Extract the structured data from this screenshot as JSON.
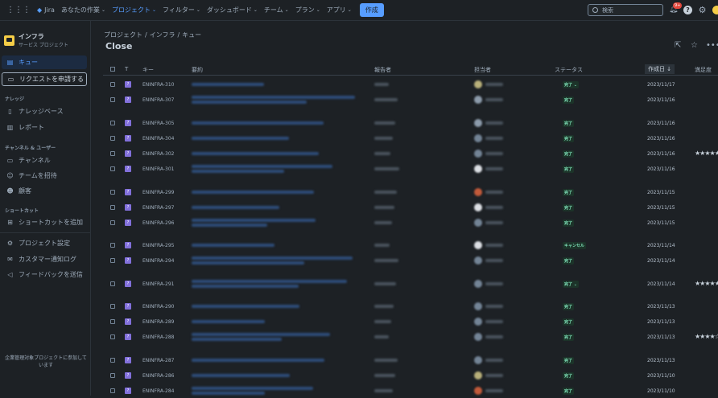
{
  "topbar": {
    "app": "Jira",
    "nav": [
      "あなたの作業",
      "プロジェクト",
      "フィルター",
      "ダッシュボード",
      "チーム",
      "プラン",
      "アプリ"
    ],
    "create": "作成",
    "search_placeholder": "検索",
    "notif_badge": "9+"
  },
  "sidebar": {
    "project_name": "インフラ",
    "project_type": "サービス プロジェクト",
    "items": [
      {
        "label": "キュー",
        "icon": "queue-icon"
      },
      {
        "label": "リクエストを申請する",
        "icon": "request-icon"
      }
    ],
    "sec_knowledge": "ナレッジ",
    "knowledge": [
      {
        "label": "ナレッジベース",
        "icon": "book-icon"
      },
      {
        "label": "レポート",
        "icon": "chart-icon"
      }
    ],
    "sec_channels": "チャンネル & ユーザー",
    "channels": [
      {
        "label": "チャンネル",
        "icon": "monitor-icon"
      },
      {
        "label": "チームを招待",
        "icon": "person-add-icon"
      },
      {
        "label": "顧客",
        "icon": "people-icon"
      }
    ],
    "sec_shortcuts": "ショートカット",
    "shortcuts": [
      {
        "label": "ショートカットを追加",
        "icon": "add-shortcut-icon"
      }
    ],
    "bottom": [
      {
        "label": "プロジェクト設定",
        "icon": "gear-icon"
      },
      {
        "label": "カスタマー通知ログ",
        "icon": "mail-icon"
      },
      {
        "label": "フィードバックを送信",
        "icon": "megaphone-icon"
      }
    ],
    "footer": "企業管理対象プロジェクトに参加しています"
  },
  "main": {
    "breadcrumb": [
      "プロジェクト",
      "インフラ",
      "キュー"
    ],
    "title": "Close"
  },
  "table": {
    "headers": {
      "type": "T",
      "key": "キー",
      "summary": "要約",
      "reporter": "報告者",
      "assignee": "担当者",
      "status": "ステータス",
      "created": "作成日 ↓",
      "satisfaction": "満足度"
    },
    "rows": [
      {
        "key": "ENINFRA-310",
        "status": "完了 ⌄",
        "date": "2023/11/17",
        "stars": "",
        "two": false,
        "avatar": "#b8b07a"
      },
      {
        "key": "ENINFRA-307",
        "status": "完了",
        "date": "2023/11/16",
        "stars": "",
        "two": true,
        "avatar": "#8c9bab"
      },
      {
        "key": "ENINFRA-305",
        "status": "完了",
        "date": "2023/11/16",
        "stars": "",
        "two": false,
        "avatar": "#8c9bab"
      },
      {
        "key": "ENINFRA-304",
        "status": "完了",
        "date": "2023/11/16",
        "stars": "",
        "two": false,
        "avatar": "#738496"
      },
      {
        "key": "ENINFRA-302",
        "status": "完了",
        "date": "2023/11/16",
        "stars": "★★★★★",
        "two": false,
        "avatar": "#738496"
      },
      {
        "key": "ENINFRA-301",
        "status": "完了",
        "date": "2023/11/16",
        "stars": "",
        "two": true,
        "avatar": "#dcdfe4"
      },
      {
        "key": "ENINFRA-299",
        "status": "完了",
        "date": "2023/11/15",
        "stars": "",
        "two": false,
        "avatar": "#c25a3a"
      },
      {
        "key": "ENINFRA-297",
        "status": "完了",
        "date": "2023/11/15",
        "stars": "",
        "two": false,
        "avatar": "#dcdfe4"
      },
      {
        "key": "ENINFRA-296",
        "status": "完了",
        "date": "2023/11/15",
        "stars": "",
        "two": true,
        "avatar": "#738496"
      },
      {
        "key": "ENINFRA-295",
        "status": "キャンセル",
        "date": "2023/11/14",
        "stars": "",
        "two": false,
        "avatar": "#dcdfe4"
      },
      {
        "key": "ENINFRA-294",
        "status": "完了",
        "date": "2023/11/14",
        "stars": "",
        "two": true,
        "avatar": "#738496"
      },
      {
        "key": "ENINFRA-291",
        "status": "完了 ⌄",
        "date": "2023/11/14",
        "stars": "★★★★★",
        "two": true,
        "avatar": "#738496"
      },
      {
        "key": "ENINFRA-290",
        "status": "完了",
        "date": "2023/11/13",
        "stars": "",
        "two": false,
        "avatar": "#738496"
      },
      {
        "key": "ENINFRA-289",
        "status": "完了",
        "date": "2023/11/13",
        "stars": "",
        "two": false,
        "avatar": "#738496"
      },
      {
        "key": "ENINFRA-288",
        "status": "完了",
        "date": "2023/11/13",
        "stars": "★★★★☆",
        "two": true,
        "avatar": "#738496"
      },
      {
        "key": "ENINFRA-287",
        "status": "完了",
        "date": "2023/11/13",
        "stars": "",
        "two": false,
        "avatar": "#738496"
      },
      {
        "key": "ENINFRA-286",
        "status": "完了",
        "date": "2023/11/10",
        "stars": "",
        "two": false,
        "avatar": "#b8b07a"
      },
      {
        "key": "ENINFRA-284",
        "status": "完了",
        "date": "2023/11/10",
        "stars": "",
        "two": true,
        "avatar": "#c25a3a"
      }
    ]
  }
}
